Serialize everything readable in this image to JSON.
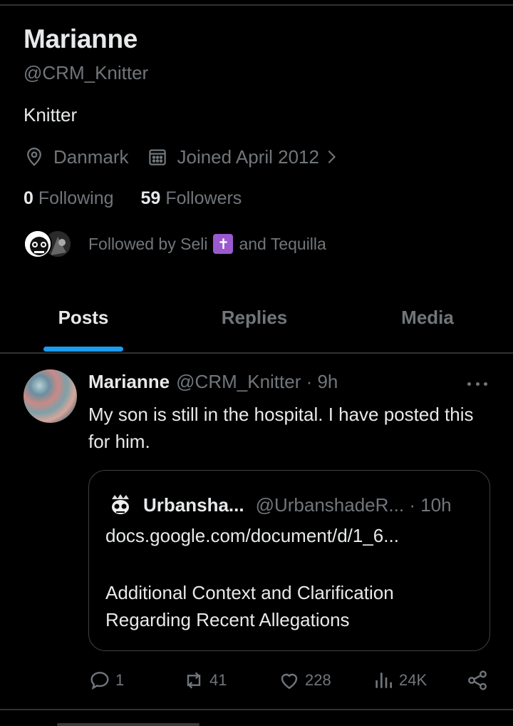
{
  "profile": {
    "name": "Marianne",
    "handle": "@CRM_Knitter",
    "bio": "Knitter",
    "location": "Danmark",
    "joined": "Joined April 2012",
    "following_count": "0",
    "following_label": "Following",
    "followers_count": "59",
    "followers_label": "Followers",
    "followed_by_prefix": "Followed by Seli",
    "followed_by_suffix": "and Tequilla",
    "cross_glyph": "✝"
  },
  "tabs": [
    {
      "label": "Posts",
      "active": true
    },
    {
      "label": "Replies",
      "active": false
    },
    {
      "label": "Media",
      "active": false
    }
  ],
  "post": {
    "author_name": "Marianne",
    "author_meta": "@CRM_Knitter · 9h",
    "text": "My son is still in the hospital. I have posted this for him.",
    "quote": {
      "name": "Urbansha...",
      "meta": "@UrbanshadeR... · 10h",
      "link": "docs.google.com/document/d/1_6...",
      "body": "Additional Context and Clarification Regarding Recent Allegations"
    },
    "actions": {
      "replies": "1",
      "reposts": "41",
      "likes": "228",
      "views": "24K"
    }
  },
  "colors": {
    "background": "#000000",
    "text": "#e7e9ea",
    "muted": "#71767b",
    "accent": "#1d9bf0",
    "divider": "#2f3336"
  }
}
